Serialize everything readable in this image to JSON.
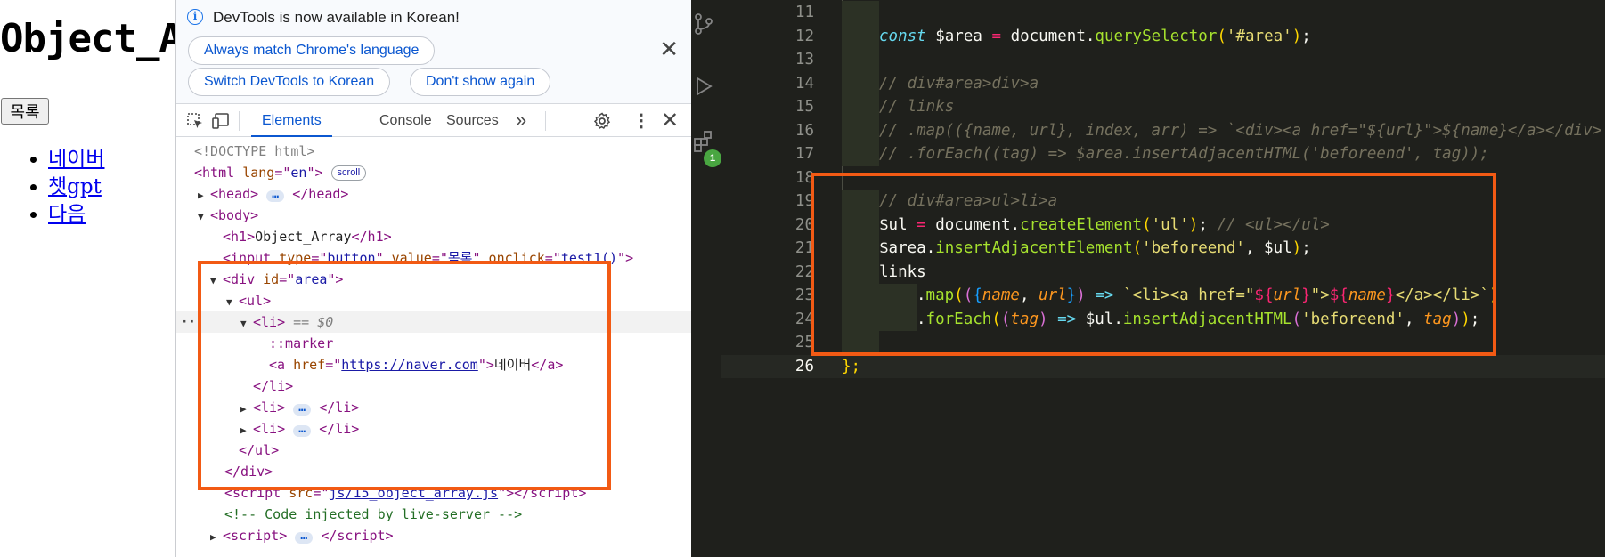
{
  "page": {
    "heading": "Object_Array",
    "list_button_label": "목록",
    "links": [
      "네이버",
      "챗gpt",
      "다음"
    ]
  },
  "devtools": {
    "infobar": {
      "message": "DevTools is now available in Korean!",
      "btn_match_language": "Always match Chrome's language",
      "btn_switch_korean": "Switch DevTools to Korean",
      "btn_dont_show": "Don't show again",
      "close": "✕"
    },
    "tabs": [
      {
        "label": "Elements",
        "active": true
      },
      {
        "label": "Console",
        "active": false
      },
      {
        "label": "Sources",
        "active": false
      }
    ],
    "overflow_label": "»",
    "scroll_badge": "scroll",
    "eq_marker": "== $0",
    "tree": {
      "doctype": "<!DOCTYPE html>",
      "html_lang": "en",
      "h1_text": "Object_Array",
      "input_attrs": {
        "type": "button",
        "value": "목록",
        "onclick": "test1()"
      },
      "div_id": "area",
      "marker": "::marker",
      "a_href": "https://naver.com",
      "a_text": "네이버",
      "script_src": "js/15_object_array.js",
      "comment": "<!-- Code injected by live-server -->"
    }
  },
  "editor": {
    "lines": [
      {
        "num": "11"
      },
      {
        "num": "12"
      },
      {
        "num": "13"
      },
      {
        "num": "14"
      },
      {
        "num": "15"
      },
      {
        "num": "16"
      },
      {
        "num": "17"
      },
      {
        "num": "18"
      },
      {
        "num": "19"
      },
      {
        "num": "20"
      },
      {
        "num": "21"
      },
      {
        "num": "22"
      },
      {
        "num": "23"
      },
      {
        "num": "24"
      },
      {
        "num": "25"
      },
      {
        "num": "26"
      }
    ],
    "code": {
      "l12_kw": "const",
      "l12_var": "$area",
      "l12_obj": "document",
      "l12_fn": "querySelector",
      "l12_str": "'#area'",
      "l14": "// div#area>div>a",
      "l15": "// links",
      "l16": "//     .map(({name, url}, index, arr) => `<div><a href=\"${url}\">${name}</a></div>`)",
      "l17": "//     .forEach((tag) => $area.insertAdjacentHTML('beforeend', tag));",
      "l19": "// div#area>ul>li>a",
      "l20_var": "$ul",
      "l20_obj": "document",
      "l20_fn": "createElement",
      "l20_str": "'ul'",
      "l20_comment": "// <ul></ul>",
      "l21_var": "$area",
      "l21_fn": "insertAdjacentElement",
      "l21_str": "'beforeend'",
      "l21_arg": "$ul",
      "l22": "links",
      "l23_fn": "map",
      "l23_p1": "name",
      "l23_p2": "url",
      "l23_tpl_a": "`<li><a href=\"",
      "l23_tpl_url": "url",
      "l23_tpl_b": "\">",
      "l23_tpl_name": "name",
      "l23_tpl_c": "</a></li>`",
      "l24_fn": "forEach",
      "l24_p": "tag",
      "l24_var": "$ul",
      "l24_fn2": "insertAdjacentHTML",
      "l24_str": "'beforeend'",
      "l24_arg": "tag",
      "l26": "};"
    },
    "badge_count": "1"
  },
  "colors": {
    "highlight": "#f25a14",
    "editor_bg": "#1f201c",
    "devtools_accent": "#0b57d0"
  }
}
